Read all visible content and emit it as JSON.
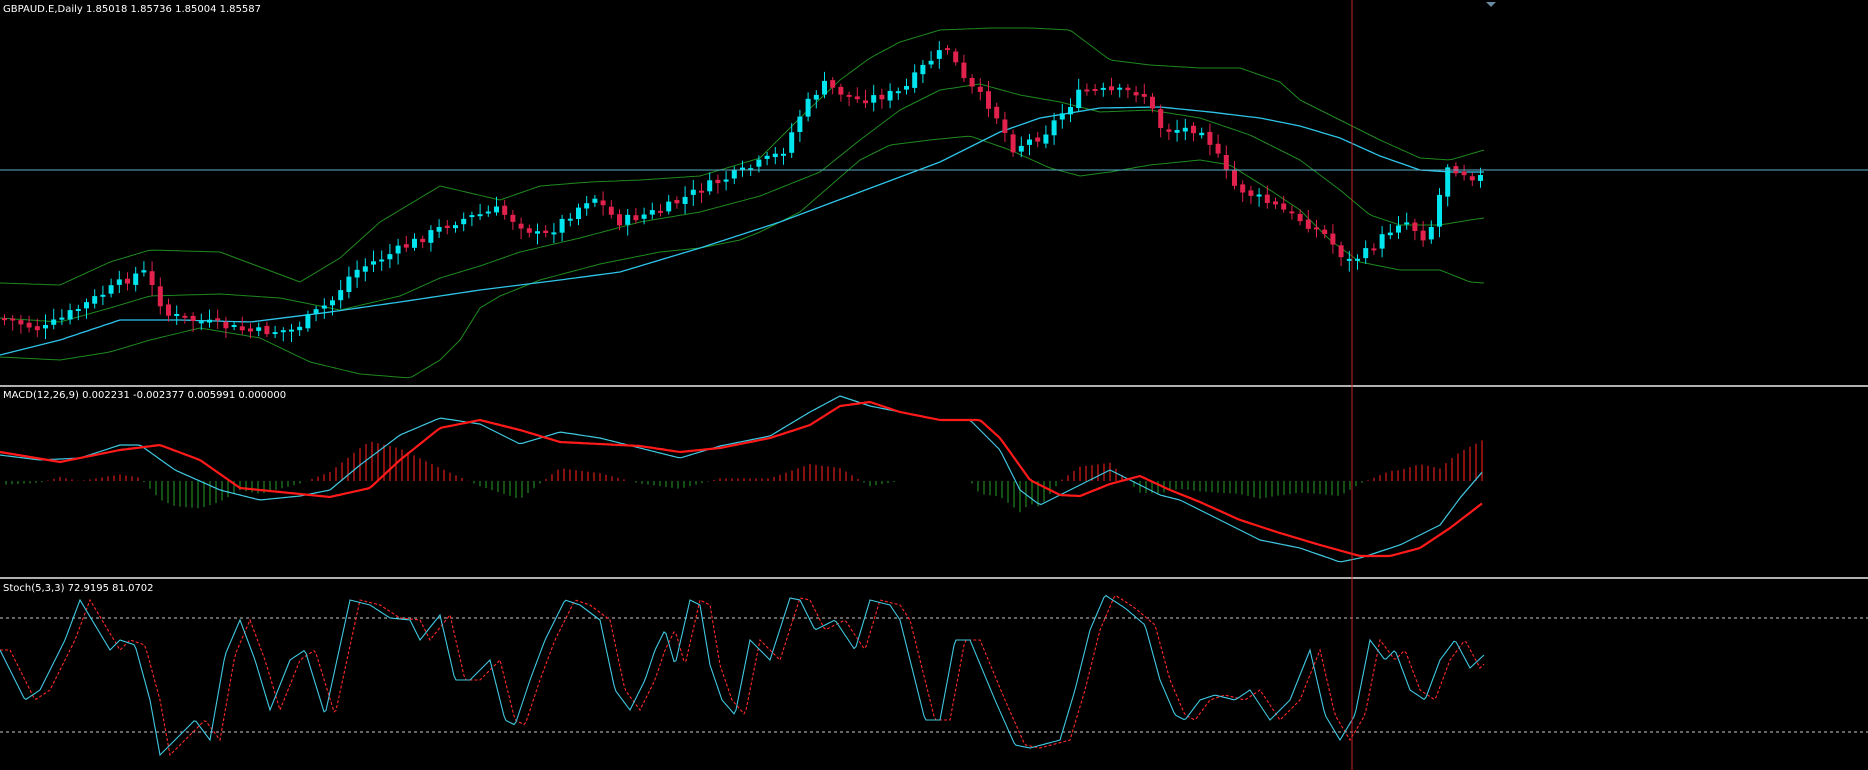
{
  "colors": {
    "background": "#000000",
    "bull_candle": "#00e5ee",
    "bear_candle": "#e0224d",
    "bollinger": "#1f8a1f",
    "ma": "#2ec4e8",
    "macd_line": "#40c8e0",
    "signal_line": "#ff1a1a",
    "hist_pos": "#cc1a1a",
    "hist_neg": "#1f7a1f",
    "stoch_k": "#40c8e0",
    "stoch_d": "#ff2a2a",
    "crosshair_v": "#cc2222",
    "crosshair_h": "#5ab0c8",
    "levels": "#c8c8c8",
    "separator": "#b0b0b0"
  },
  "panes": {
    "price_label": "GBPAUD.E,Daily  1.85018 1.85736 1.85004 1.85587",
    "macd_label": "MACD(12,26,9) 0.002231 -0.002377 0.005991 0.000000",
    "stoch_label": "Stoch(5,3,3) 72.9195 81.0702"
  },
  "chart_data": [
    {
      "type": "candlestick",
      "name": "GBPAUD.E,Daily",
      "last_ohlc": {
        "open": 1.85018,
        "high": 1.85736,
        "low": 1.85004,
        "close": 1.85587
      },
      "overlays": [
        "Bollinger Bands",
        "Moving Average"
      ]
    },
    {
      "type": "line",
      "name": "MACD(12,26,9)",
      "values": [
        0.002231,
        -0.002377,
        0.005991,
        0.0
      ]
    },
    {
      "type": "line",
      "name": "Stoch(5,3,3)",
      "k": 72.9195,
      "d": 81.0702,
      "levels": [
        80,
        20
      ],
      "ylim": [
        0,
        100
      ]
    }
  ]
}
